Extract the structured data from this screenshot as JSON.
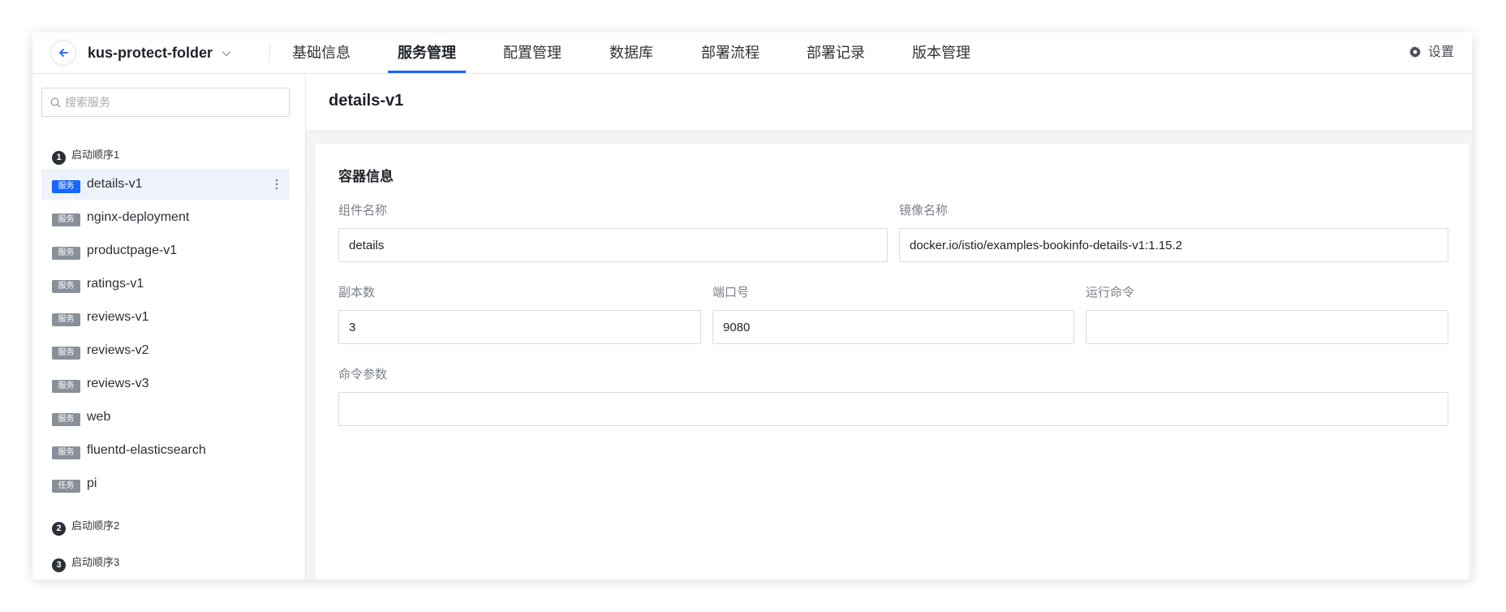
{
  "header": {
    "project_name": "kus-protect-folder",
    "tabs": [
      {
        "label": "基础信息"
      },
      {
        "label": "服务管理"
      },
      {
        "label": "配置管理"
      },
      {
        "label": "数据库"
      },
      {
        "label": "部署流程"
      },
      {
        "label": "部署记录"
      },
      {
        "label": "版本管理"
      }
    ],
    "active_tab": "服务管理",
    "settings_label": "设置"
  },
  "sidebar": {
    "search_placeholder": "搜索服务",
    "groups": [
      {
        "number": "1",
        "title": "启动顺序1"
      },
      {
        "number": "2",
        "title": "启动顺序2"
      },
      {
        "number": "3",
        "title": "启动顺序3"
      }
    ],
    "services": [
      {
        "badge": "服务",
        "name": "details-v1"
      },
      {
        "badge": "服务",
        "name": "nginx-deployment"
      },
      {
        "badge": "服务",
        "name": "productpage-v1"
      },
      {
        "badge": "服务",
        "name": "ratings-v1"
      },
      {
        "badge": "服务",
        "name": "reviews-v1"
      },
      {
        "badge": "服务",
        "name": "reviews-v2"
      },
      {
        "badge": "服务",
        "name": "reviews-v3"
      },
      {
        "badge": "服务",
        "name": "web"
      },
      {
        "badge": "服务",
        "name": "fluentd-elasticsearch"
      },
      {
        "badge": "任务",
        "name": "pi"
      }
    ],
    "selected_service": "details-v1"
  },
  "main": {
    "title": "details-v1",
    "section_title": "容器信息",
    "fields": {
      "component_name": {
        "label": "组件名称",
        "value": "details"
      },
      "image_name": {
        "label": "镜像名称",
        "value": "docker.io/istio/examples-bookinfo-details-v1:1.15.2"
      },
      "replicas": {
        "label": "副本数",
        "value": "3"
      },
      "port": {
        "label": "端口号",
        "value": "9080"
      },
      "run_command": {
        "label": "运行命令",
        "value": ""
      },
      "command_args": {
        "label": "命令参数",
        "value": ""
      }
    }
  },
  "colors": {
    "accent": "#1766ff",
    "selected_row_bg": "#eef2fb",
    "badge_gray": "#8a9099"
  }
}
